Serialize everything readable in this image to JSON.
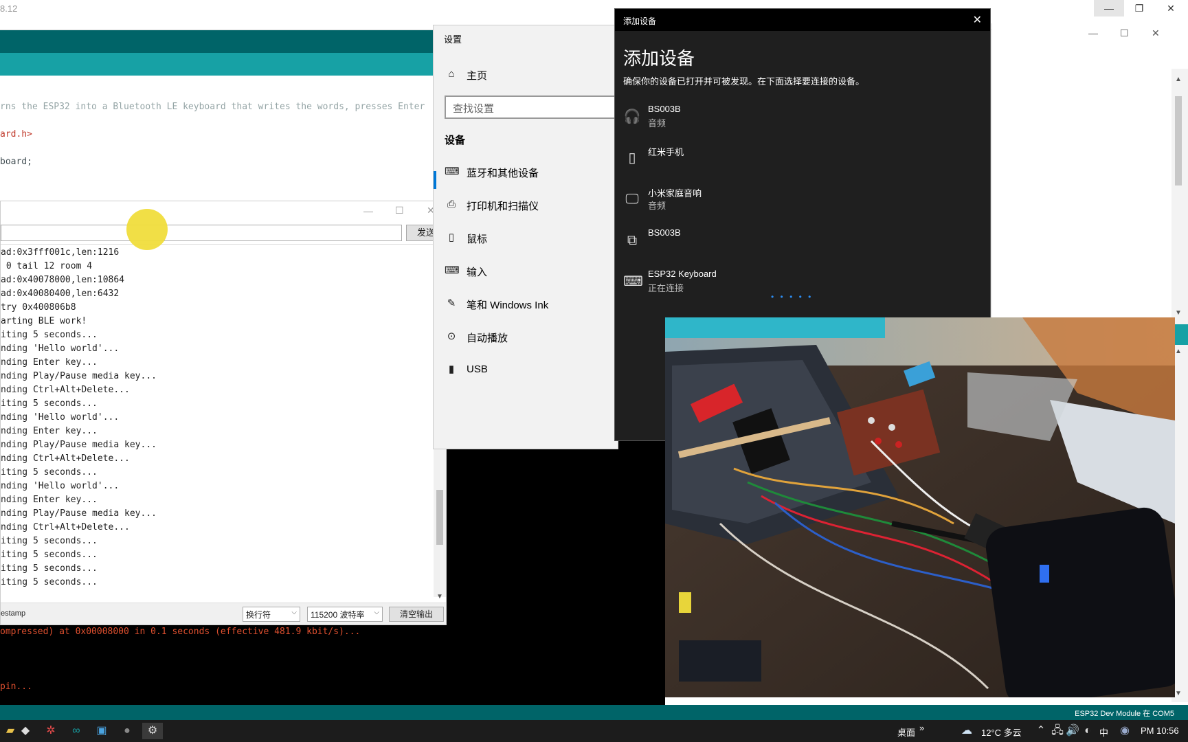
{
  "ide": {
    "title_fragment": "8.12",
    "code_lines": [
      {
        "text": "rns the ESP32 into a Bluetooth LE keyboard that writes the words, presses Enter",
        "style": "comment"
      },
      {
        "text": "ard.h>",
        "style": "orange"
      },
      {
        "text": "board;",
        "style": "normal"
      }
    ],
    "status_right": "ESP32 Dev Module 在 COM5",
    "console_lines": [
      "ompressed) at 0x00008000 in 0.1 seconds (effective 481.9 kbit/s)...",
      "pin..."
    ]
  },
  "serial_monitor": {
    "send_label": "发送",
    "output_lines": [
      "ad:0x3fff001c,len:1216",
      " 0 tail 12 room 4",
      "ad:0x40078000,len:10864",
      "ad:0x40080400,len:6432",
      "try 0x400806b8",
      "arting BLE work!",
      "iting 5 seconds...",
      "nding 'Hello world'...",
      "nding Enter key...",
      "nding Play/Pause media key...",
      "nding Ctrl+Alt+Delete...",
      "iting 5 seconds...",
      "nding 'Hello world'...",
      "nding Enter key...",
      "nding Play/Pause media key...",
      "nding Ctrl+Alt+Delete...",
      "iting 5 seconds...",
      "nding 'Hello world'...",
      "nding Enter key...",
      "nding Play/Pause media key...",
      "nding Ctrl+Alt+Delete...",
      "iting 5 seconds...",
      "iting 5 seconds...",
      "iting 5 seconds...",
      "iting 5 seconds..."
    ],
    "timestamp_label": "estamp",
    "line_ending": "换行符",
    "baud_rate": "115200 波特率",
    "clear_label": "清空输出"
  },
  "settings": {
    "title": "设置",
    "home_label": "主页",
    "search_placeholder": "查找设置",
    "section_title": "设备",
    "items": [
      {
        "label": "蓝牙和其他设备",
        "icon": "bluetooth-devices-icon",
        "glyph": "⌨"
      },
      {
        "label": "打印机和扫描仪",
        "icon": "printer-icon",
        "glyph": "⎙"
      },
      {
        "label": "鼠标",
        "icon": "mouse-icon",
        "glyph": "▯"
      },
      {
        "label": "输入",
        "icon": "keyboard-icon",
        "glyph": "⌨"
      },
      {
        "label": "笔和 Windows Ink",
        "icon": "pen-icon",
        "glyph": "✎"
      },
      {
        "label": "自动播放",
        "icon": "autoplay-icon",
        "glyph": "⊙"
      },
      {
        "label": "USB",
        "icon": "usb-icon",
        "glyph": "▮"
      }
    ]
  },
  "add_device": {
    "window_title": "添加设备",
    "heading": "添加设备",
    "description": "确保你的设备已打开并可被发现。在下面选择要连接的设备。",
    "devices": [
      {
        "name": "BS003B",
        "sub": "音频",
        "icon": "headphones-icon",
        "glyph": "🎧"
      },
      {
        "name": "红米手机",
        "sub": "",
        "icon": "phone-icon",
        "glyph": "▯"
      },
      {
        "name": "小米家庭音响",
        "sub": "音频",
        "icon": "monitor-icon",
        "glyph": "🖵"
      },
      {
        "name": "BS003B",
        "sub": "",
        "icon": "devices-icon",
        "glyph": "⧉"
      },
      {
        "name": "ESP32 Keyboard",
        "sub": "正在连接",
        "icon": "keyboard-icon",
        "glyph": "⌨"
      }
    ],
    "progress_dots": "• • • • •"
  },
  "taskbar": {
    "desktop_label": "桌面",
    "weather": "12°C 多云",
    "ime": "中",
    "time": "PM 10:56"
  },
  "colors": {
    "arduino_dark": "#006468",
    "arduino_teal": "#17a1a5",
    "windows_accent": "#0078d7",
    "cursor_highlight": "#f0dd3c"
  }
}
